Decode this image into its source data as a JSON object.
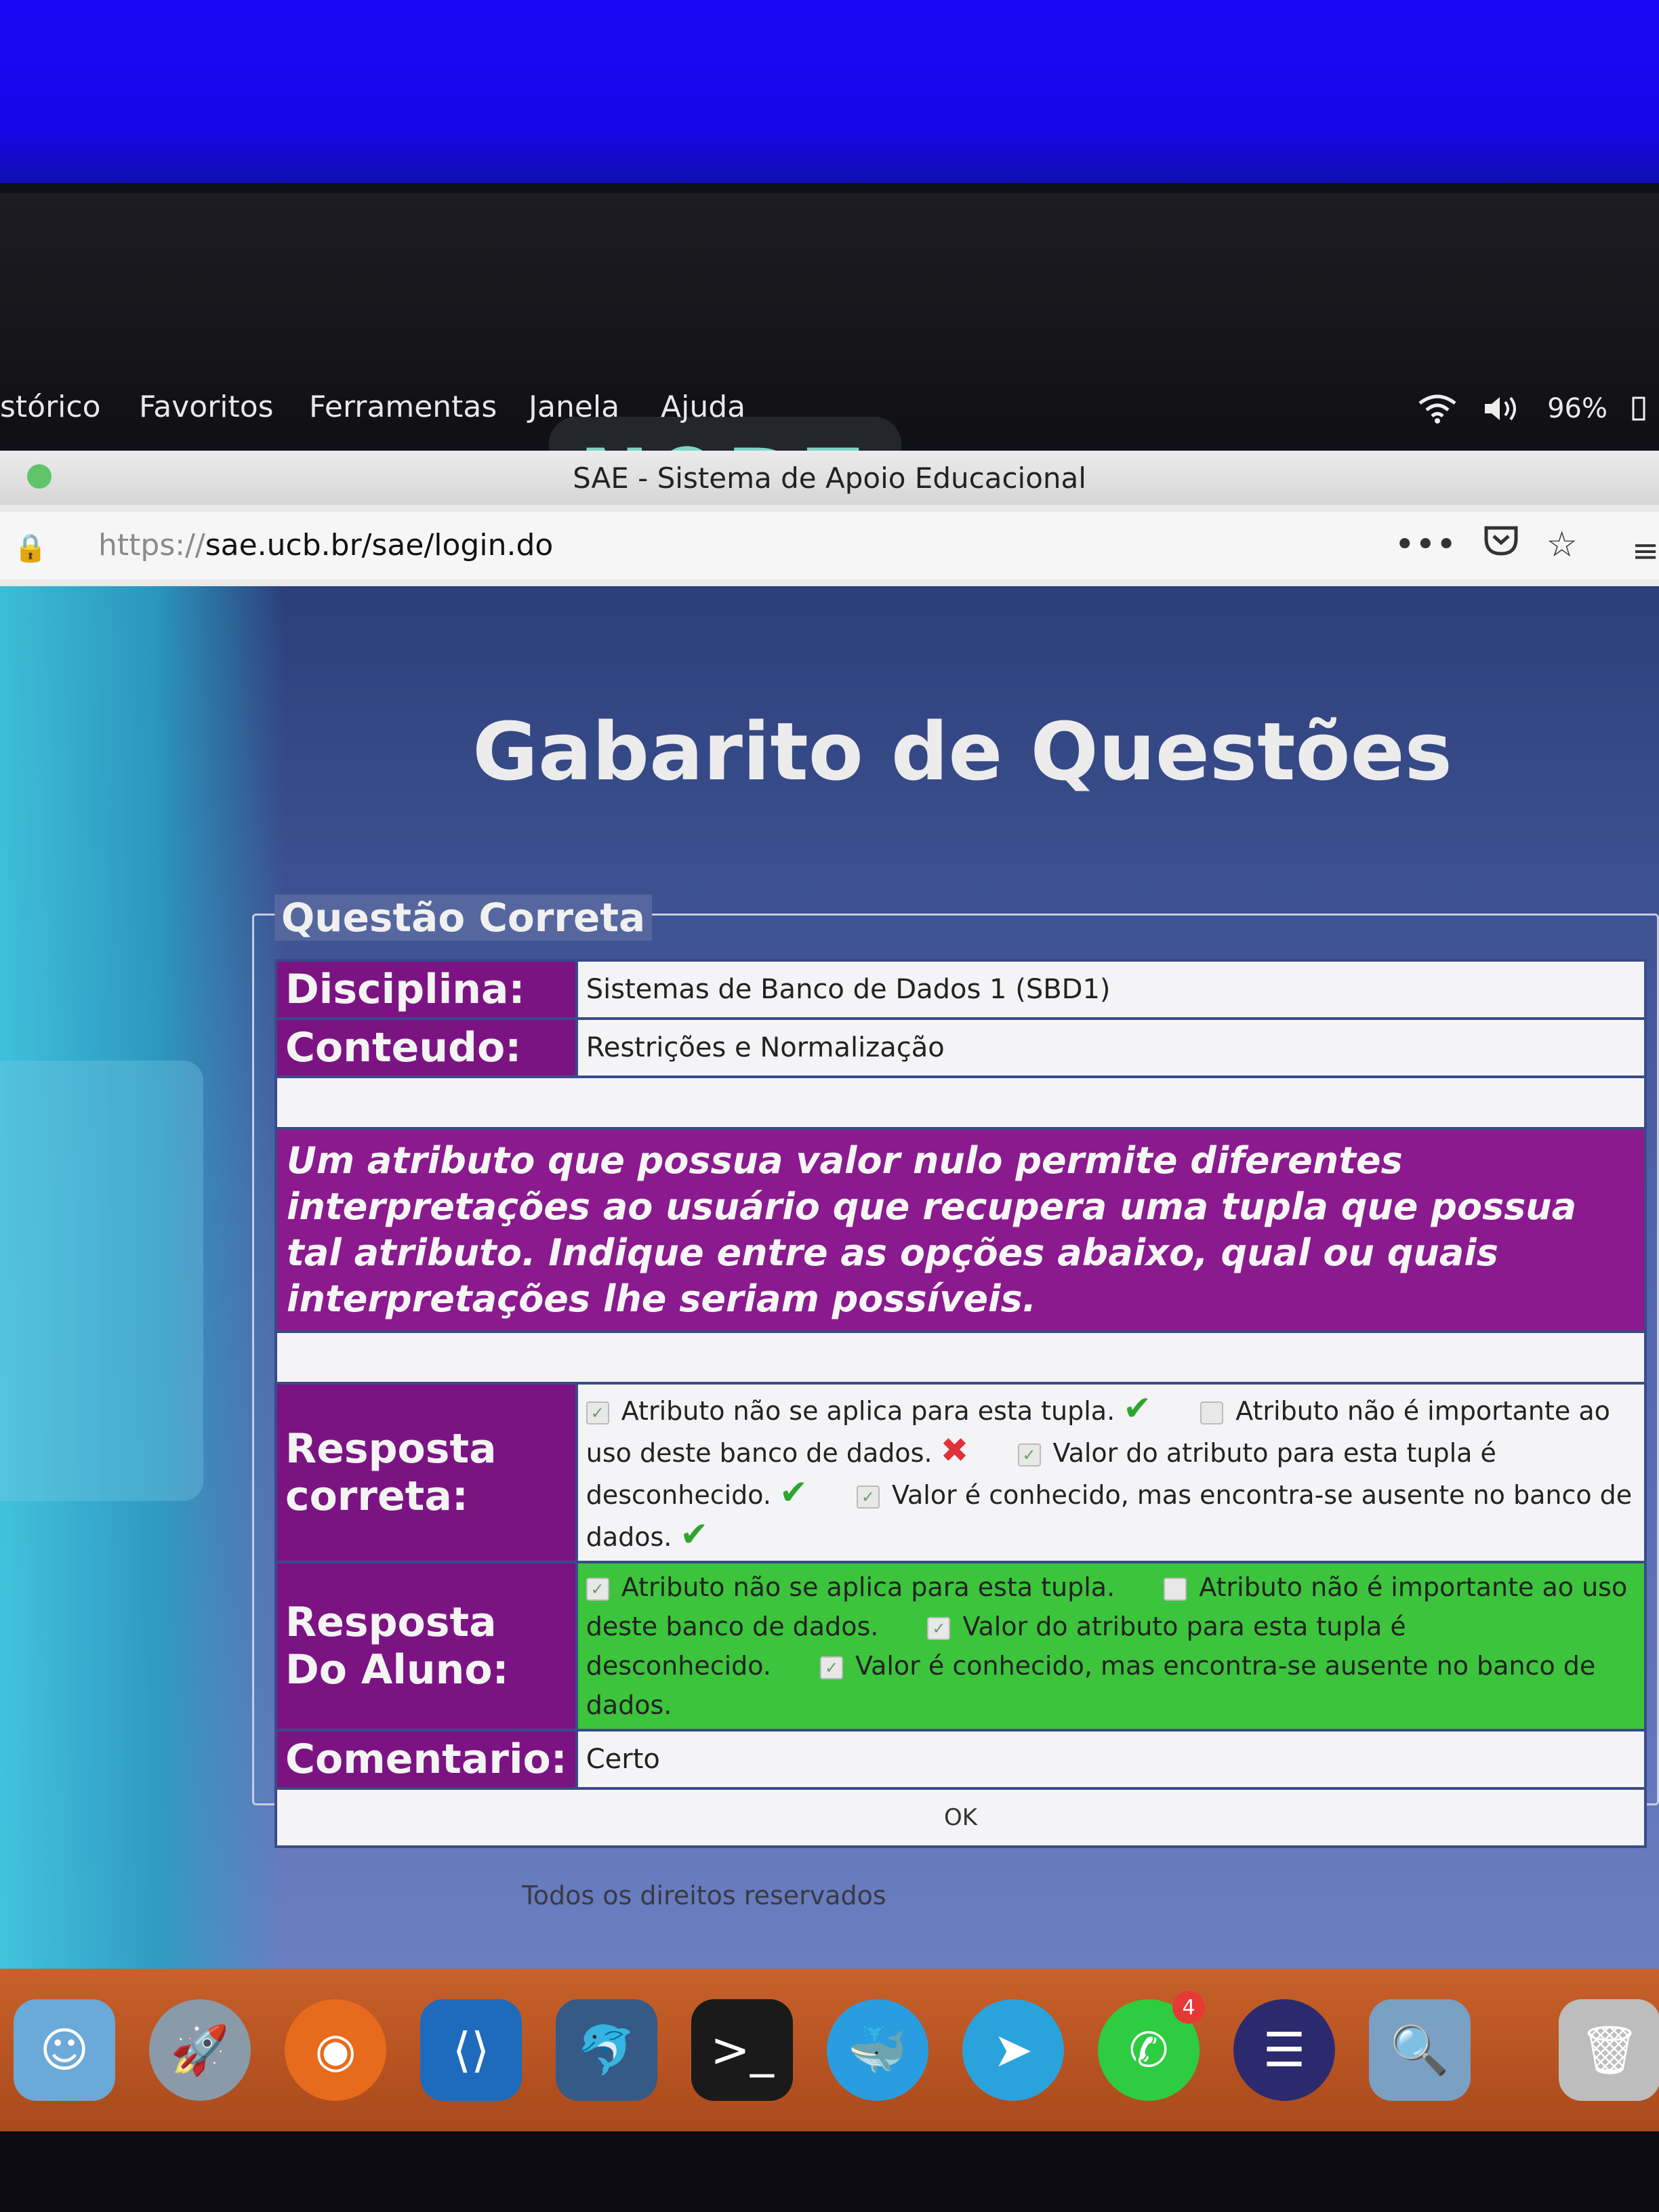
{
  "menubar": {
    "notch_label": "NOPE",
    "items": [
      "stórico",
      "Favoritos",
      "Ferramentas",
      "Janela",
      "Ajuda"
    ],
    "battery": "96%",
    "icons": [
      "wifi-icon",
      "volume-icon",
      "battery-icon"
    ]
  },
  "browser": {
    "window_title": "SAE - Sistema de Apoio Educacional",
    "url_prefix": "https://",
    "url_host": "sae.ucb.br/sae/login.do",
    "actions": [
      "more-icon",
      "pocket-icon",
      "bookmark-star-icon"
    ]
  },
  "page": {
    "title": "Gabarito de Questões",
    "legend": "Questão Correta",
    "rows": {
      "disciplina_label": "Disciplina:",
      "disciplina_value": "Sistemas de Banco de Dados 1 (SBD1)",
      "conteudo_label": "Conteudo:",
      "conteudo_value": "Restrições e Normalização",
      "question": "Um atributo que possua valor nulo permite diferentes interpretações ao usuário que recupera uma tupla que possua tal atributo. Indique entre as opções abaixo, qual ou quais interpretações lhe seriam possíveis.",
      "resposta_correta_label": "Resposta correta:",
      "resposta_aluno_label": "Resposta Do Aluno:",
      "comentario_label": "Comentario:",
      "comentario_value": "Certo",
      "ok_label": "OK"
    },
    "correct_options": [
      {
        "text": "Atributo não se aplica para esta tupla.",
        "checked": true,
        "mark": "✔"
      },
      {
        "text": "Atributo não é importante ao uso deste banco de dados.",
        "checked": false,
        "mark": "✖"
      },
      {
        "text": "Valor do atributo para esta tupla é desconhecido.",
        "checked": true,
        "mark": "✔"
      },
      {
        "text": "Valor é conhecido, mas encontra-se ausente no banco de dados.",
        "checked": true,
        "mark": "✔"
      }
    ],
    "student_options": [
      {
        "text": "Atributo não se aplica para esta tupla.",
        "checked": true
      },
      {
        "text": "Atributo não é importante ao uso deste banco de dados.",
        "checked": false
      },
      {
        "text": "Valor do atributo para esta tupla é desconhecido.",
        "checked": true
      },
      {
        "text": "Valor é conhecido, mas encontra-se ausente no banco de dados.",
        "checked": true
      }
    ],
    "footer": "Todos os direitos reservados"
  },
  "dock": {
    "apps": [
      "finder-icon",
      "launchpad-icon",
      "firefox-icon",
      "vscode-icon",
      "mysql-workbench-icon",
      "terminal-icon",
      "docker-icon",
      "telegram-icon",
      "whatsapp-icon",
      "eclipse-icon",
      "preview-icon",
      "trash-icon"
    ],
    "whatsapp_badge": "4"
  },
  "colors": {
    "label_purple": "#7b1482",
    "student_green": "#3cc43c",
    "check_green": "#2fa52f",
    "wrong_red": "#e0303a"
  }
}
